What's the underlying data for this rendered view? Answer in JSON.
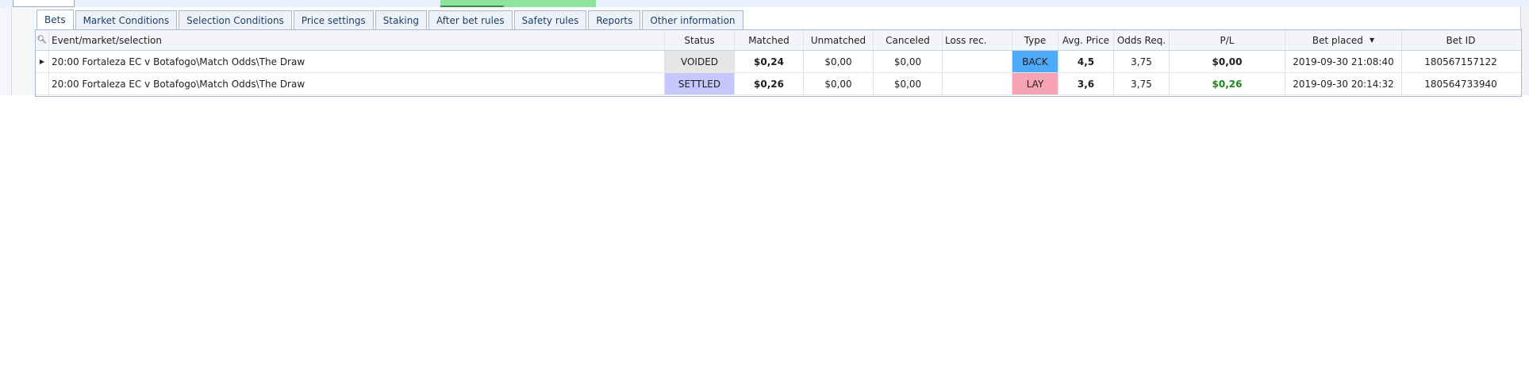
{
  "tabs": [
    {
      "label": "Bets",
      "active": true
    },
    {
      "label": "Market Conditions",
      "active": false
    },
    {
      "label": "Selection Conditions",
      "active": false
    },
    {
      "label": "Price settings",
      "active": false
    },
    {
      "label": "Staking",
      "active": false
    },
    {
      "label": "After bet rules",
      "active": false
    },
    {
      "label": "Safety rules",
      "active": false
    },
    {
      "label": "Reports",
      "active": false
    },
    {
      "label": "Other information",
      "active": false
    }
  ],
  "grid": {
    "search_icon": "magnifier-icon",
    "headers": {
      "event": "Event/market/selection",
      "status": "Status",
      "matched": "Matched",
      "unmatched": "Unmatched",
      "canceled": "Canceled",
      "loss_rec": "Loss rec.",
      "type": "Type",
      "avg_price": "Avg. Price",
      "odds_req": "Odds Req.",
      "pl": "P/L",
      "bet_placed": "Bet placed",
      "bet_id": "Bet ID"
    },
    "sort": {
      "column": "bet_placed",
      "direction": "descending"
    },
    "rows": [
      {
        "selected": true,
        "event": "20:00 Fortaleza EC v Botafogo\\Match Odds\\The Draw",
        "status": "VOIDED",
        "matched": "$0,24",
        "unmatched": "$0,00",
        "canceled": "$0,00",
        "loss_rec": "",
        "type": "BACK",
        "avg_price": "4,5",
        "odds_req": "3,75",
        "pl": "$0,00",
        "bet_placed": "2019-09-30 21:08:40",
        "bet_id": "180567157122"
      },
      {
        "selected": false,
        "event": "20:00 Fortaleza EC v Botafogo\\Match Odds\\The Draw",
        "status": "SETTLED",
        "matched": "$0,26",
        "unmatched": "$0,00",
        "canceled": "$0,00",
        "loss_rec": "",
        "type": "LAY",
        "avg_price": "3,6",
        "odds_req": "3,75",
        "pl": "$0,26",
        "bet_placed": "2019-09-30 20:14:32",
        "bet_id": "180564733940"
      }
    ]
  },
  "colors": {
    "status_voided": "#e6e6e6",
    "status_settled": "#c7c7ff",
    "type_back": "#4daaf8",
    "type_lay": "#f7a3b6",
    "pl_positive": "#1a8a1a"
  }
}
